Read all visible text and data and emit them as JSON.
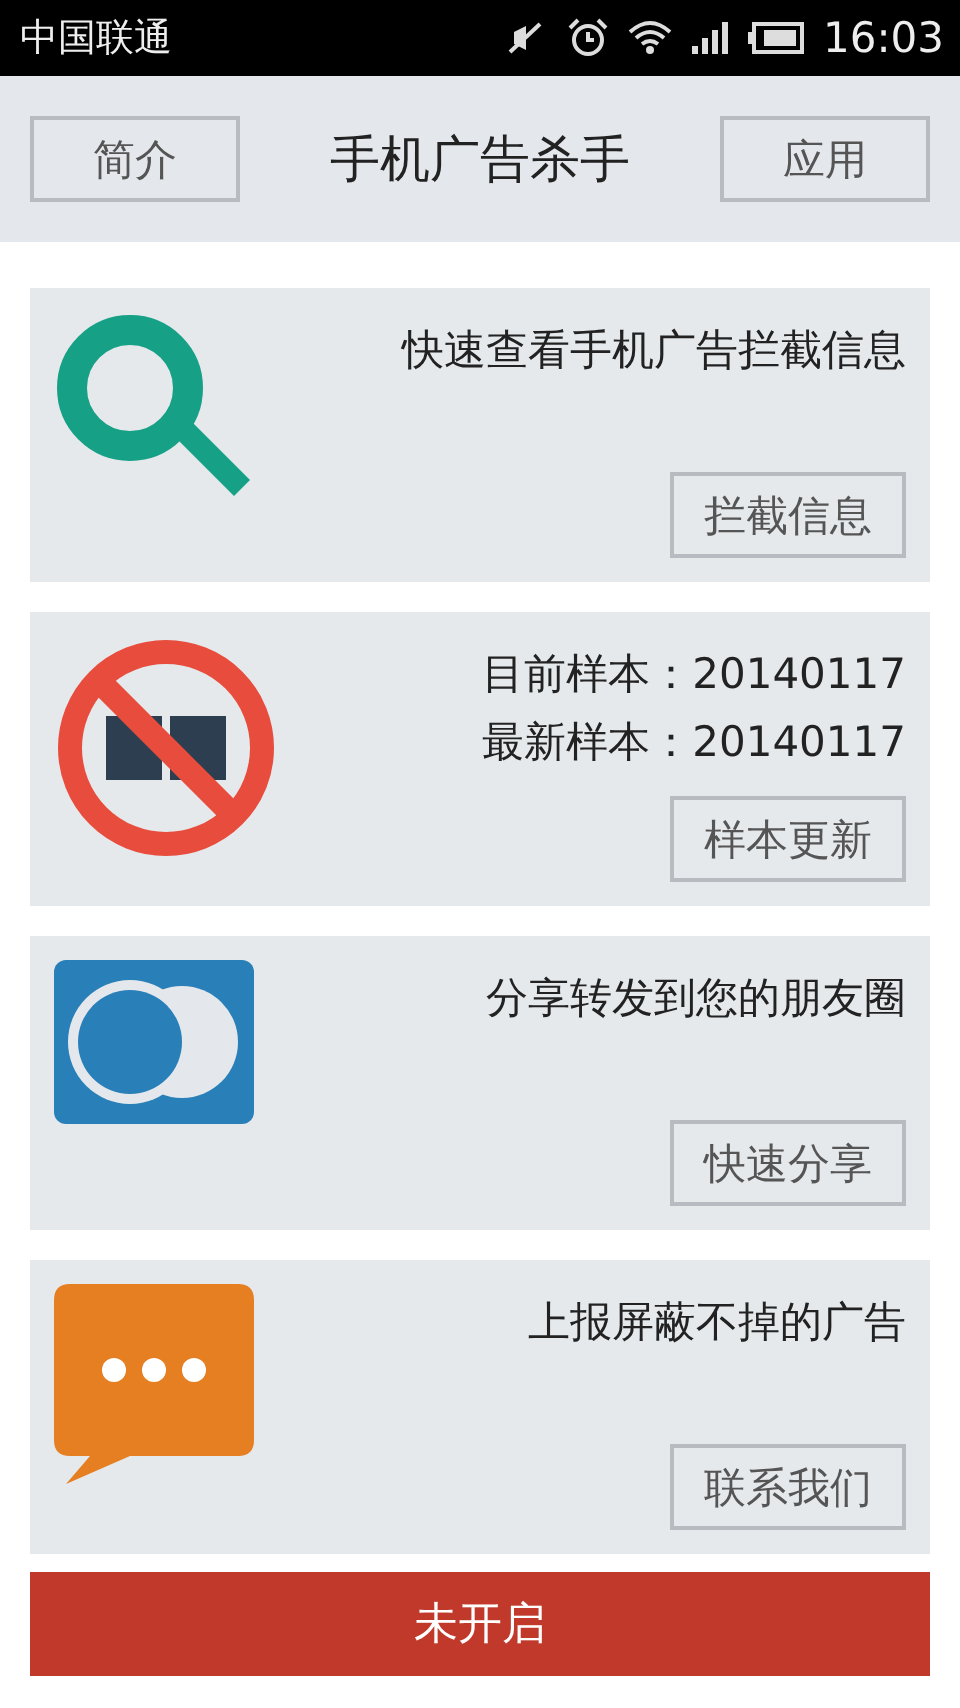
{
  "status_bar": {
    "carrier": "中国联通",
    "time": "16:03"
  },
  "header": {
    "left_button": "简介",
    "title": "手机广告杀手",
    "right_button": "应用"
  },
  "cards": [
    {
      "kind": "search",
      "lines": [
        "快速查看手机广告拦截信息"
      ],
      "button": "拦截信息"
    },
    {
      "kind": "noad",
      "lines": [
        "目前样本：20140117",
        "最新样本：20140117"
      ],
      "button": "样本更新"
    },
    {
      "kind": "share",
      "lines": [
        "分享转发到您的朋友圈"
      ],
      "button": "快速分享"
    },
    {
      "kind": "chat",
      "lines": [
        "上报屏蔽不掉的广告"
      ],
      "button": "联系我们"
    }
  ],
  "main_button": "未开启"
}
